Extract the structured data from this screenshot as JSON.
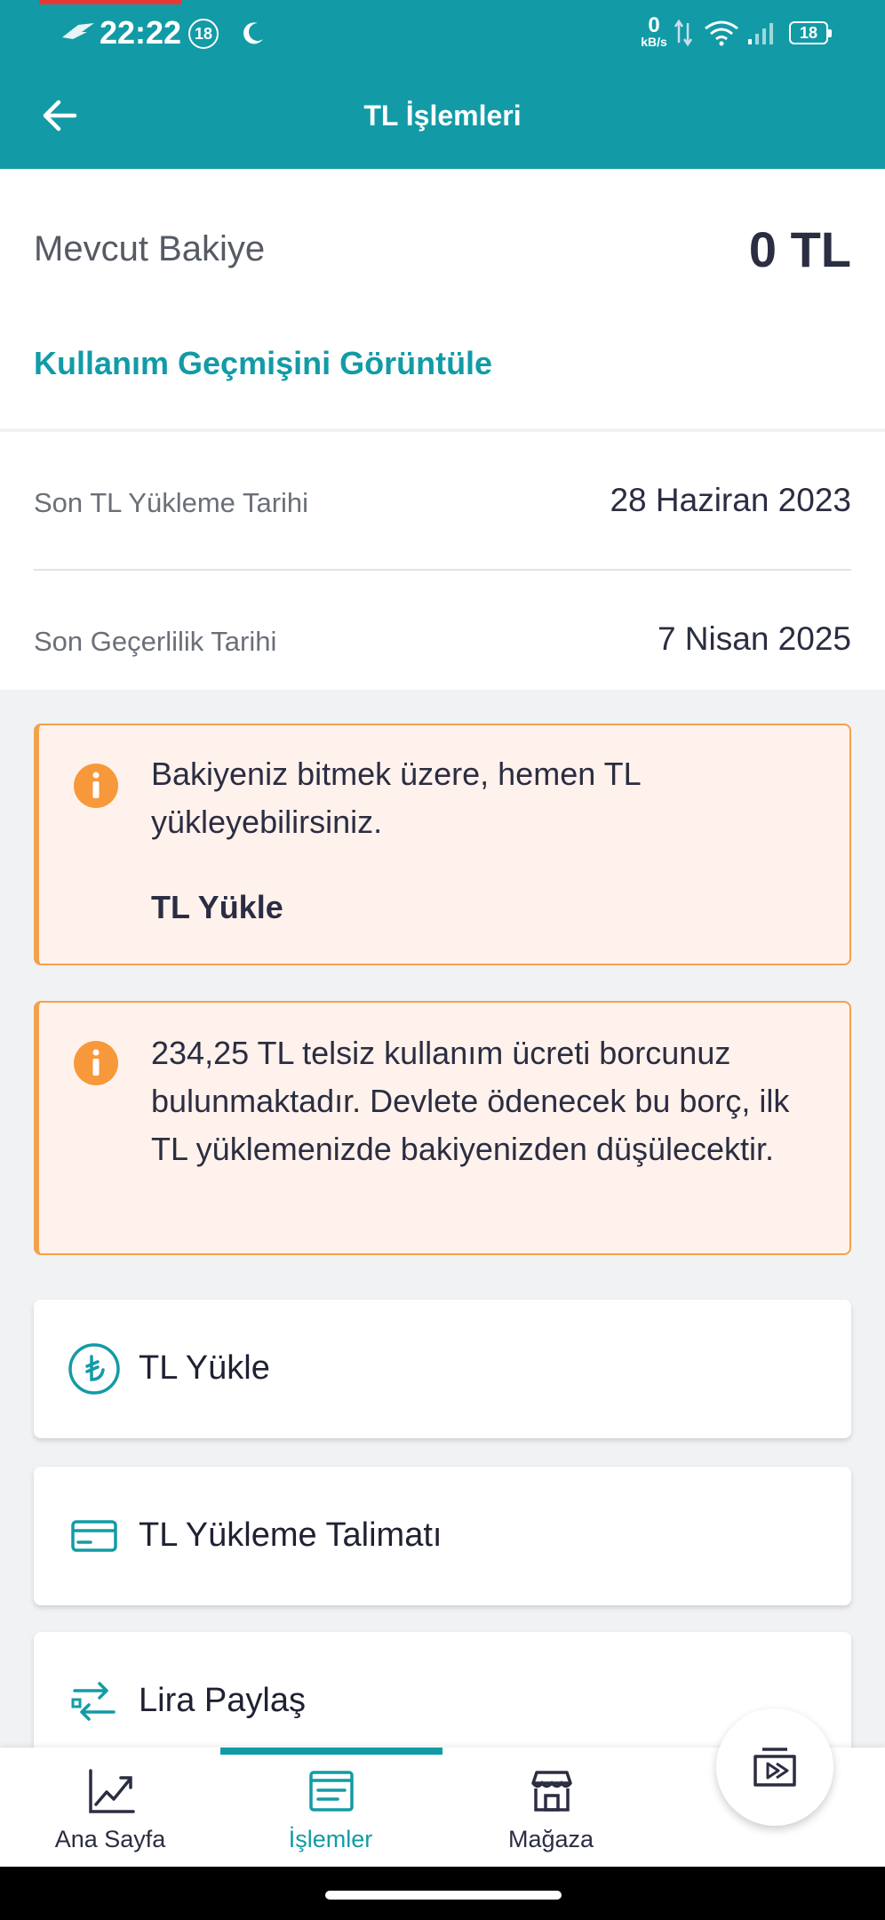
{
  "status_bar": {
    "time": "22:22",
    "notification_badge": "18",
    "network_speed_value": "0",
    "network_speed_unit": "kB/s",
    "battery_level": "18"
  },
  "appbar": {
    "title": "TL İşlemleri",
    "back_icon": "arrow-left-icon"
  },
  "balance": {
    "label": "Mevcut Bakiye",
    "value": "0 TL",
    "history_link": "Kullanım Geçmişini Görüntüle"
  },
  "dates": [
    {
      "label": "Son TL Yükleme Tarihi",
      "value": "28 Haziran 2023"
    },
    {
      "label": "Son Geçerlilik Tarihi",
      "value": "7 Nisan 2025"
    }
  ],
  "alerts": [
    {
      "icon": "info-icon",
      "text": "Bakiyeniz bitmek üzere, hemen TL yükleyebilirsiniz.",
      "action": "TL Yükle"
    },
    {
      "icon": "info-icon",
      "text": "234,25 TL telsiz kullanım ücreti borcunuz bulunmaktadır. Devlete ödenecek bu borç, ilk TL yüklemenizde bakiyenizden düşülecektir."
    }
  ],
  "menu": [
    {
      "icon": "lira-circle-icon",
      "label": "TL Yükle"
    },
    {
      "icon": "credit-card-icon",
      "label": "TL Yükleme Talimatı"
    },
    {
      "icon": "transfer-arrows-icon",
      "label": "Lira Paylaş"
    }
  ],
  "bottom_nav": {
    "items": [
      {
        "icon": "chart-line-icon",
        "label": "Ana Sayfa"
      },
      {
        "icon": "list-document-icon",
        "label": "İşlemler",
        "active": true
      },
      {
        "icon": "store-icon",
        "label": "Mağaza"
      }
    ],
    "fab_icon": "media-play-icon"
  },
  "colors": {
    "brand_teal": "#129ba6",
    "alert_border": "#f4a14c",
    "alert_background": "#fff2ec",
    "info_icon": "#f7993a"
  }
}
